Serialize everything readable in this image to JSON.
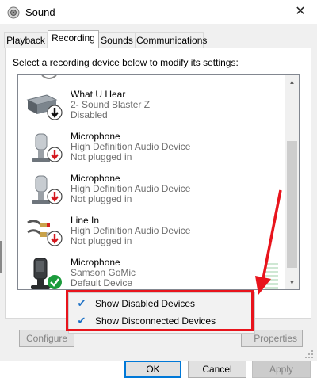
{
  "window": {
    "title": "Sound",
    "close_glyph": "✕",
    "icon": "speaker-icon"
  },
  "tabs": [
    {
      "label": "Playback",
      "active": false
    },
    {
      "label": "Recording",
      "active": true
    },
    {
      "label": "Sounds",
      "active": false
    },
    {
      "label": "Communications",
      "active": false
    }
  ],
  "instruction": "Select a recording device below to modify its settings:",
  "devices": [
    {
      "name": "What U Hear",
      "desc": "2- Sound Blaster Z",
      "status": "Disabled",
      "icon": "sound-card-icon",
      "badge": "down-arrow-black"
    },
    {
      "name": "Microphone",
      "desc": "High Definition Audio Device",
      "status": "Not plugged in",
      "icon": "microphone-icon",
      "badge": "down-arrow-red"
    },
    {
      "name": "Microphone",
      "desc": "High Definition Audio Device",
      "status": "Not plugged in",
      "icon": "microphone-icon",
      "badge": "down-arrow-red"
    },
    {
      "name": "Line In",
      "desc": "High Definition Audio Device",
      "status": "Not plugged in",
      "icon": "line-in-jack-icon",
      "badge": "down-arrow-red"
    },
    {
      "name": "Microphone",
      "desc": "Samson GoMic",
      "status": "Default Device",
      "icon": "usb-microphone-icon",
      "badge": "checkmark-green"
    }
  ],
  "behind_buttons": {
    "configure": "Configure",
    "properties": "Properties"
  },
  "context_menu": [
    {
      "label": "Show Disabled Devices",
      "checked": true
    },
    {
      "label": "Show Disconnected Devices",
      "checked": true
    }
  ],
  "check_glyph": "✔",
  "buttons": {
    "ok": "OK",
    "cancel": "Cancel",
    "apply": "Apply"
  },
  "colors": {
    "annotation_red": "#e8141c",
    "accent": "#0078d7",
    "check_blue": "#1a6fc5"
  }
}
